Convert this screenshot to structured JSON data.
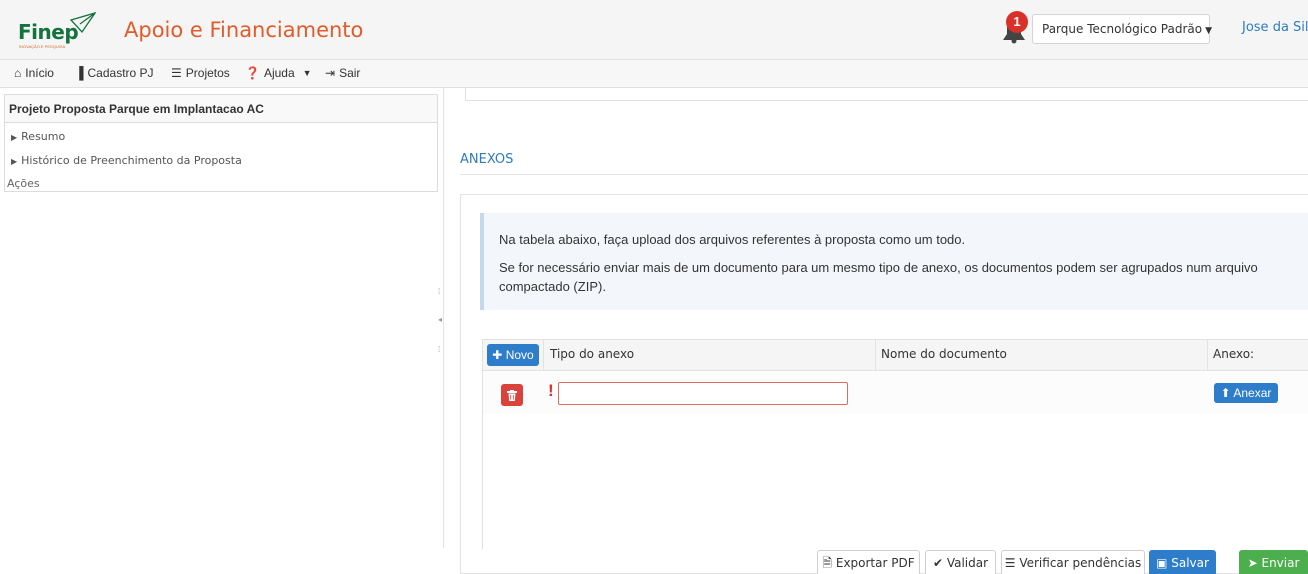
{
  "header": {
    "logo_text": "Finep",
    "logo_tagline": "INOVAÇÃO E PESQUISA",
    "app_title": "Apoio e Financiamento",
    "notification_count": "1",
    "park_selector": "Parque Tecnológico Padrão",
    "user_name": "Jose da Silva",
    "colors": {
      "brand_green": "#14723c",
      "title_orange": "#e05c2a",
      "link_blue": "#2e7dba"
    }
  },
  "nav": {
    "items": [
      {
        "label": "Início",
        "icon": "home-icon"
      },
      {
        "label": "Cadastro PJ",
        "icon": "building-icon"
      },
      {
        "label": "Projetos",
        "icon": "list-icon"
      },
      {
        "label": "Ajuda",
        "icon": "help-icon"
      },
      {
        "label": "Sair",
        "icon": "sign-out-icon"
      }
    ]
  },
  "sidebar": {
    "title": "Projeto Proposta Parque em Implantacao AC",
    "items": [
      {
        "label": "Resumo"
      },
      {
        "label": "Histórico de Preenchimento da Proposta"
      }
    ],
    "actions_label": "Ações"
  },
  "main": {
    "section_title": "ANEXOS",
    "info_lines": [
      "Na tabela abaixo, faça upload dos arquivos referentes à proposta como um todo.",
      "Se for necessário enviar mais de um documento para um mesmo tipo de anexo, os documentos podem ser agrupados num arquivo",
      "compactado (ZIP)."
    ],
    "table": {
      "new_button": "Novo",
      "columns": [
        "Tipo do anexo",
        "Nome do documento",
        "Anexo:"
      ],
      "rows": [
        {
          "type_value": "",
          "required_mark": "!",
          "attach_button": "Anexar"
        }
      ]
    }
  },
  "footer": {
    "export_pdf": "Exportar PDF",
    "validate": "Validar",
    "check_pending": "Verificar pendências",
    "save": "Salvar",
    "send": "Enviar"
  }
}
